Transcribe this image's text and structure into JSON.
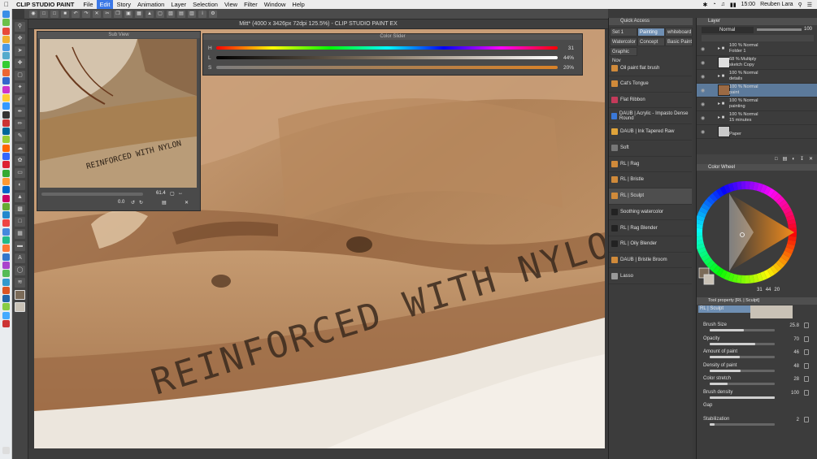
{
  "menubar": {
    "app_name": "CLIP STUDIO PAINT",
    "items": [
      "File",
      "Edit",
      "Story",
      "Animation",
      "Layer",
      "Selection",
      "View",
      "Filter",
      "Window",
      "Help"
    ],
    "active_item": "Edit",
    "clock": "15:00",
    "user": "Reuben Lara",
    "icons": [
      "apple-icon",
      "wifi-icon",
      "battery-icon",
      "volume-icon",
      "bluetooth-icon",
      "spotlight-icon",
      "notification-icon"
    ]
  },
  "document": {
    "title": "Mitt* (4000 x 3426px 72dpi 125.5%) - CLIP STUDIO PAINT EX",
    "canvas_text": "REINFORCED WITH NYLON"
  },
  "subview": {
    "title": "Sub View",
    "image_text": "REINFORCED WITH NYLON",
    "zoom": "61.4",
    "angle": "0.0"
  },
  "color_slider": {
    "title": "Color Slider",
    "rows": [
      {
        "label": "H",
        "value": "31"
      },
      {
        "label": "L",
        "value": "44%"
      },
      {
        "label": "S",
        "value": "20%"
      }
    ],
    "h_level": 0.98,
    "l_level": 0.72,
    "s_level": 0.2
  },
  "quick_access": {
    "title": "Quick Access",
    "tabs": [
      "Set 1",
      "Painting",
      "whiteboard",
      "Watercolor",
      "Concept",
      "Basic Paint",
      "Graphic Nov"
    ],
    "selected_tab": "Painting",
    "items": [
      {
        "label": "Oil paint flat brush",
        "color": "#d08a3a"
      },
      {
        "label": "Cat's Tongue",
        "color": "#d08a3a"
      },
      {
        "label": "Flat Ribbon",
        "color": "#c43a5a"
      },
      {
        "label": "DAUB | Acrylic - Impasto Dense Round",
        "color": "#3a78d8"
      },
      {
        "label": "DAUB | Ink Tapered Raw",
        "color": "#e0a43a"
      },
      {
        "label": "Soft",
        "color": "#777777"
      },
      {
        "label": "RL | Rag",
        "color": "#d08a3a"
      },
      {
        "label": "RL | Bristle",
        "color": "#d08a3a"
      },
      {
        "label": "RL | Sculpt",
        "color": "#d08a3a"
      },
      {
        "label": "Soothing watercolor",
        "color": "#222222"
      },
      {
        "label": "RL | Rag Blender",
        "color": "#222222"
      },
      {
        "label": "RL | Oily Blender",
        "color": "#222222"
      },
      {
        "label": "DAUB | Bristle Broom",
        "color": "#d08a3a"
      },
      {
        "label": "Lasso",
        "color": "#999999"
      }
    ],
    "selected_item": "RL | Sculpt"
  },
  "layer_panel": {
    "title": "Layer",
    "blend_mode": "Normal",
    "opacity": "100",
    "layers": [
      {
        "line1": "100 % Normal",
        "line2": "Folder 1",
        "kind": "folder"
      },
      {
        "line1": "68 % Multiply",
        "line2": "sketch Copy",
        "kind": "layer"
      },
      {
        "line1": "100 % Normal",
        "line2": "details",
        "kind": "folder"
      },
      {
        "line1": "100 % Normal",
        "line2": "paint",
        "kind": "layer"
      },
      {
        "line1": "100 % Normal",
        "line2": "painting",
        "kind": "folder"
      },
      {
        "line1": "100 % Normal",
        "line2": "15 minutes",
        "kind": "folder"
      },
      {
        "line1": "",
        "line2": "Paper",
        "kind": "paper"
      }
    ],
    "selected_layer": "paint"
  },
  "color_wheel": {
    "title": "Color Wheel",
    "values": [
      "31",
      "44",
      "20"
    ],
    "main_color": "#7b6b58",
    "sub_color": "#c9c2b6"
  },
  "tool_property": {
    "title": "Tool property [RL | Sculpt]",
    "tool_name": "RL | Sculpt",
    "rows": [
      {
        "label": "Brush Size",
        "value": "25.8",
        "level": 0.52
      },
      {
        "label": "Opacity",
        "value": "70",
        "level": 0.7
      },
      {
        "label": "Amount of paint",
        "value": "46",
        "level": 0.46
      },
      {
        "label": "Density of paint",
        "value": "48",
        "level": 0.48
      },
      {
        "label": "Color stretch",
        "value": "28",
        "level": 0.28
      },
      {
        "label": "Brush density",
        "value": "100",
        "level": 1.0
      },
      {
        "label": "Gap",
        "value": "",
        "level": 0
      },
      {
        "label": "Stabilization",
        "value": "2",
        "level": 0.08
      }
    ]
  }
}
